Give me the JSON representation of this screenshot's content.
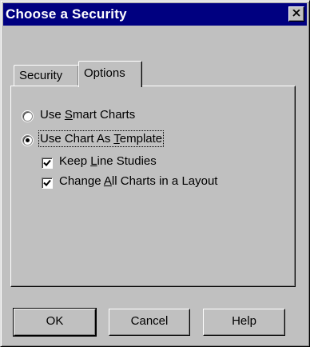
{
  "window": {
    "title": "Choose a Security"
  },
  "tabs": [
    {
      "label": "Security",
      "active": false
    },
    {
      "label": "Options",
      "active": true
    }
  ],
  "options": {
    "radio_smart": {
      "pre": "Use ",
      "key": "S",
      "post": "mart Charts",
      "checked": false
    },
    "radio_template": {
      "pre": "Use Chart As ",
      "key": "T",
      "post": "emplate",
      "checked": true
    },
    "check_keep": {
      "pre": "Keep ",
      "key": "L",
      "post": "ine Studies",
      "checked": true
    },
    "check_change": {
      "pre": "Change ",
      "key": "A",
      "post": "ll Charts in a Layout",
      "checked": true
    }
  },
  "buttons": {
    "ok": "OK",
    "cancel": "Cancel",
    "help": "Help"
  },
  "icons": {
    "close": "close-icon",
    "check": "checkmark-icon"
  }
}
